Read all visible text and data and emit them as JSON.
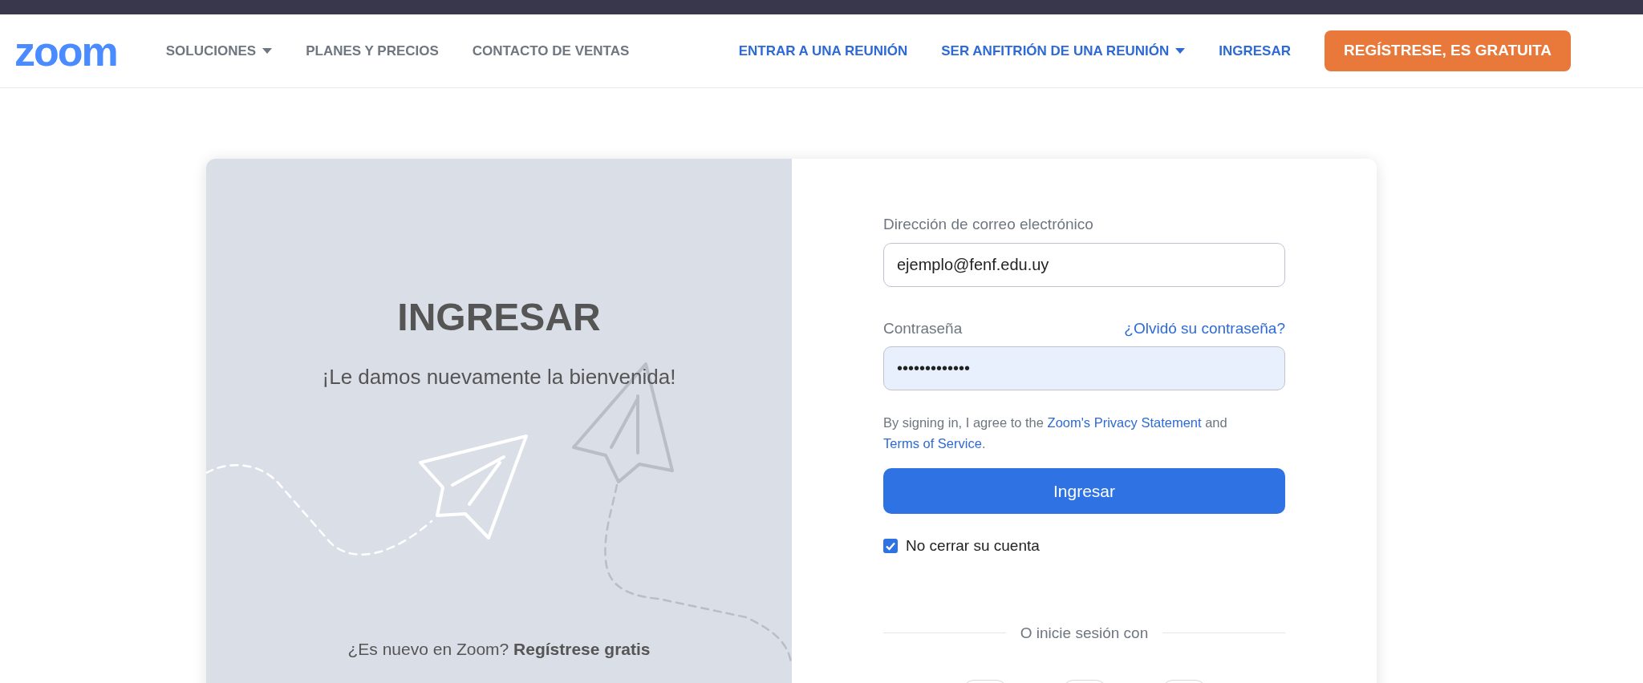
{
  "header": {
    "logo": "zoom",
    "left_nav": [
      {
        "label": "SOLUCIONES",
        "dropdown": true
      },
      {
        "label": "PLANES Y PRECIOS",
        "dropdown": false
      },
      {
        "label": "CONTACTO DE VENTAS",
        "dropdown": false
      }
    ],
    "right_nav": [
      {
        "label": "ENTRAR A UNA REUNIÓN",
        "kind": "link",
        "dropdown": false
      },
      {
        "label": "SER ANFITRIÓN DE UNA REUNIÓN",
        "kind": "link",
        "dropdown": true
      },
      {
        "label": "INGRESAR",
        "kind": "link",
        "dropdown": false
      },
      {
        "label": "REGÍSTRESE, ES GRATUITA",
        "kind": "button",
        "dropdown": false
      }
    ]
  },
  "welcome": {
    "title": "INGRESAR",
    "subtitle": "¡Le damos nuevamente la bienvenida!",
    "signup_prompt": "¿Es nuevo en Zoom?",
    "signup_link": "Regístrese gratis"
  },
  "form": {
    "email": {
      "label": "Dirección de correo electrónico",
      "value": "ejemplo@fenf.edu.uy",
      "autofilled": false
    },
    "password": {
      "label": "Contraseña",
      "link": "¿Olvidó su contraseña?",
      "value": "•••••••••••••",
      "autofilled": true
    },
    "terms": {
      "text_1": "By signing in, I agree to the ",
      "privacy_link": "Zoom's Privacy Statement",
      "text_2": " and ",
      "service_link": "Terms of Service",
      "text_3": "."
    },
    "submit": "Ingresar",
    "remember": {
      "label": "No cerrar su cuenta",
      "checked": true
    },
    "divider": "O inicie sesión con"
  }
}
